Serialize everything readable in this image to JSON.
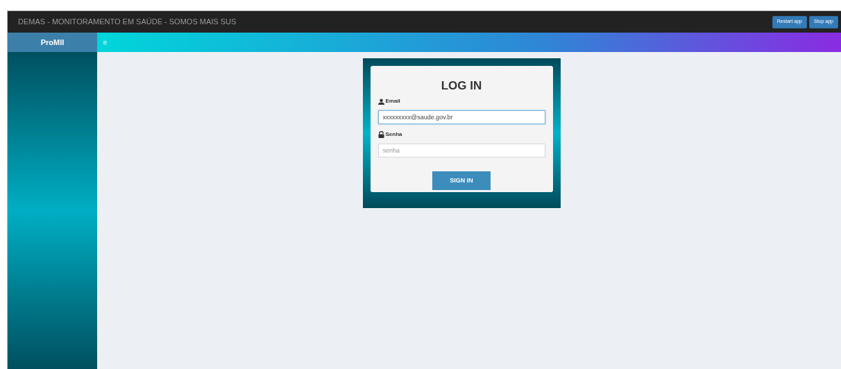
{
  "header": {
    "title": "DEMAS - MONITORAMENTO EM SAÚDE - SOMOS MAIS SUS",
    "buttons": [
      "Restart app",
      "Stop app"
    ]
  },
  "sidebar": {
    "brand": "ProMII"
  },
  "navbar": {
    "toggle": "≡"
  },
  "login": {
    "title": "LOG IN",
    "email": {
      "label": "Email",
      "value": "xxxxxxxxx@saude.gov.br",
      "focused": true
    },
    "password": {
      "label": "Senha",
      "placeholder": "senha",
      "focused": false
    },
    "button": "SIGN IN"
  }
}
